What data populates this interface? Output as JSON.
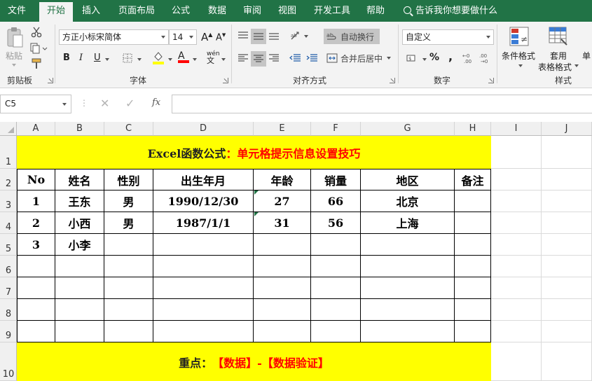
{
  "tabs": [
    "文件",
    "开始",
    "插入",
    "页面布局",
    "公式",
    "数据",
    "审阅",
    "视图",
    "开发工具",
    "帮助"
  ],
  "active_tab": 1,
  "tell_me": "告诉我你想要做什么",
  "ribbon": {
    "clipboard": {
      "paste": "粘贴",
      "label": "剪贴板"
    },
    "font": {
      "name": "方正小标宋简体",
      "size": "14",
      "grow": "A",
      "shrink": "A",
      "bold": "B",
      "italic": "I",
      "underline": "U",
      "color_a": "A",
      "phonetic": "wén",
      "label": "字体"
    },
    "alignment": {
      "wrap": "自动换行",
      "merge": "合并后居中",
      "label": "对齐方式"
    },
    "number": {
      "format": "自定义",
      "percent": "%",
      "label": "数字"
    },
    "styles": {
      "conditional": "条件格式",
      "table_l1": "套用",
      "table_l2": "表格格式",
      "cell_styles": "单",
      "label": "样式"
    }
  },
  "name_box": "C5",
  "fx_label": "fx",
  "columns": [
    "A",
    "B",
    "C",
    "D",
    "E",
    "F",
    "G",
    "H",
    "I",
    "J"
  ],
  "rows": [
    "1",
    "2",
    "3",
    "4",
    "5",
    "6",
    "7",
    "8",
    "9",
    "10"
  ],
  "title": {
    "prefix": "Excel函数公式",
    "suffix": "：单元格提示信息设置技巧"
  },
  "table": {
    "headers": [
      "No",
      "姓名",
      "性别",
      "出生年月",
      "年龄",
      "销量",
      "地区",
      "备注"
    ],
    "rows": [
      [
        "1",
        "王东",
        "男",
        "1990/12/30",
        "27",
        "66",
        "北京",
        ""
      ],
      [
        "2",
        "小西",
        "男",
        "1987/1/1",
        "31",
        "56",
        "上海",
        ""
      ],
      [
        "3",
        "小李",
        "",
        "",
        "",
        "",
        "",
        ""
      ],
      [
        "",
        "",
        "",
        "",
        "",
        "",
        "",
        ""
      ],
      [
        "",
        "",
        "",
        "",
        "",
        "",
        "",
        ""
      ],
      [
        "",
        "",
        "",
        "",
        "",
        "",
        "",
        ""
      ],
      [
        "",
        "",
        "",
        "",
        "",
        "",
        "",
        ""
      ]
    ]
  },
  "footer": {
    "label": "重点：",
    "value": "【数据】-【数据验证】"
  },
  "colors": {
    "excel_green": "#217346",
    "highlight": "#ffff00",
    "accent_red": "#ff0000"
  }
}
